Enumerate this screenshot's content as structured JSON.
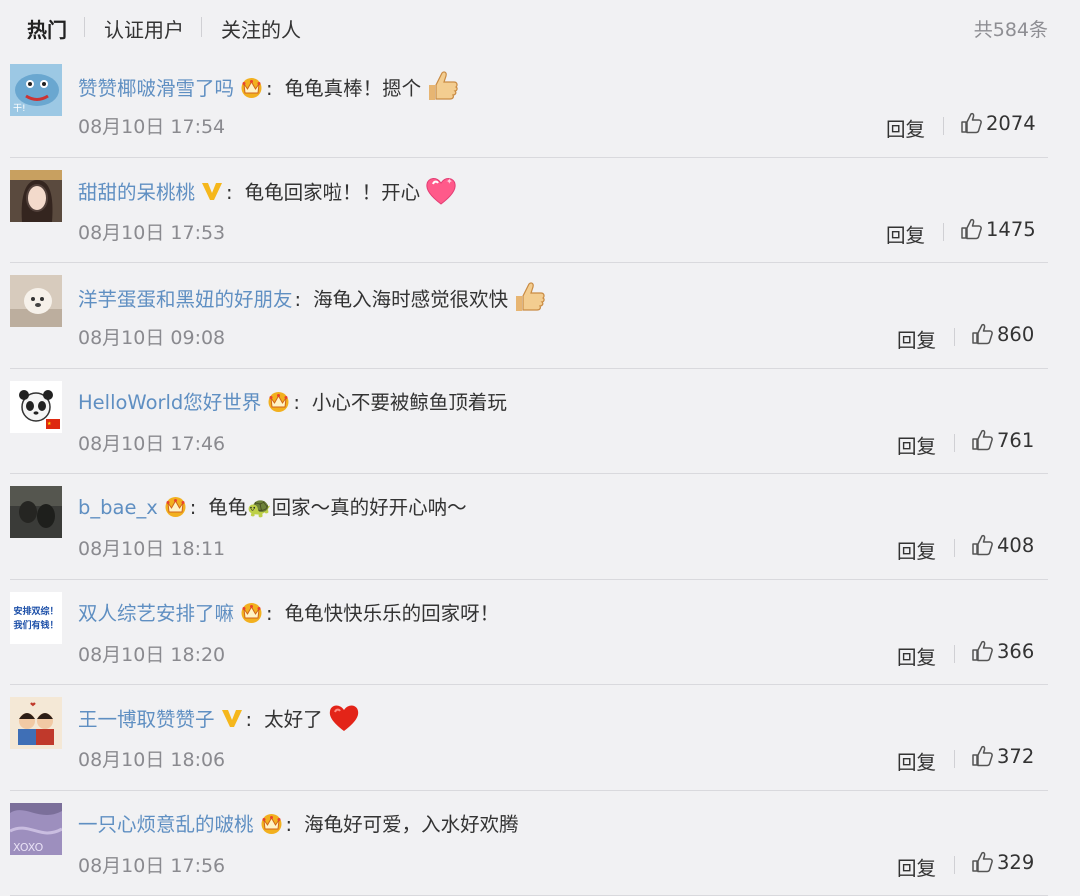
{
  "tabs": [
    {
      "label": "热门"
    },
    {
      "label": "认证用户"
    },
    {
      "label": "关注的人"
    }
  ],
  "total": "共584条",
  "reply_label": "回复",
  "colors": {
    "username": "#5f8fc2",
    "background": "#f1f1f3",
    "gold_badge": "#f2b01e"
  },
  "comments": [
    {
      "user": "赞赞椰啵滑雪了吗",
      "badge": "crown-icon",
      "text": "龟龟真棒！摁个",
      "emoji": "thumbs-up-emoji",
      "time": "08月10日 17:54",
      "likes": "2074"
    },
    {
      "user": "甜甜的呆桃桃",
      "badge": "verified-v-icon",
      "text": "龟龟回家啦！！开心",
      "emoji": "heart-emoji",
      "time": "08月10日 17:53",
      "likes": "1475"
    },
    {
      "user": "洋芋蛋蛋和黑妞的好朋友",
      "badge": "",
      "text": "海龟入海时感觉很欢快",
      "emoji": "thumbs-up-emoji",
      "time": "08月10日 09:08",
      "likes": "860"
    },
    {
      "user": "HelloWorld您好世界",
      "badge": "crown-icon",
      "text": "小心不要被鲸鱼顶着玩",
      "emoji": "",
      "time": "08月10日 17:46",
      "likes": "761"
    },
    {
      "user": "b_bae_x",
      "badge": "crown-icon",
      "text": "龟龟🐢回家～真的好开心呐～",
      "emoji": "",
      "time": "08月10日 18:11",
      "likes": "408"
    },
    {
      "user": "双人综艺安排了嘛",
      "badge": "crown-icon",
      "text": "龟龟快快乐乐的回家呀！",
      "emoji": "",
      "time": "08月10日 18:20",
      "likes": "366",
      "avatar_text": [
        "安排双综！",
        "我们有钱！"
      ]
    },
    {
      "user": "王一博取赞赞子",
      "badge": "verified-v-icon",
      "text": "太好了",
      "emoji": "red-heart-emoji",
      "time": "08月10日 18:06",
      "likes": "372"
    },
    {
      "user": "一只心烦意乱的啵桃",
      "badge": "crown-icon",
      "text": "海龟好可爱，入水好欢腾",
      "emoji": "",
      "time": "08月10日 17:56",
      "likes": "329"
    }
  ]
}
